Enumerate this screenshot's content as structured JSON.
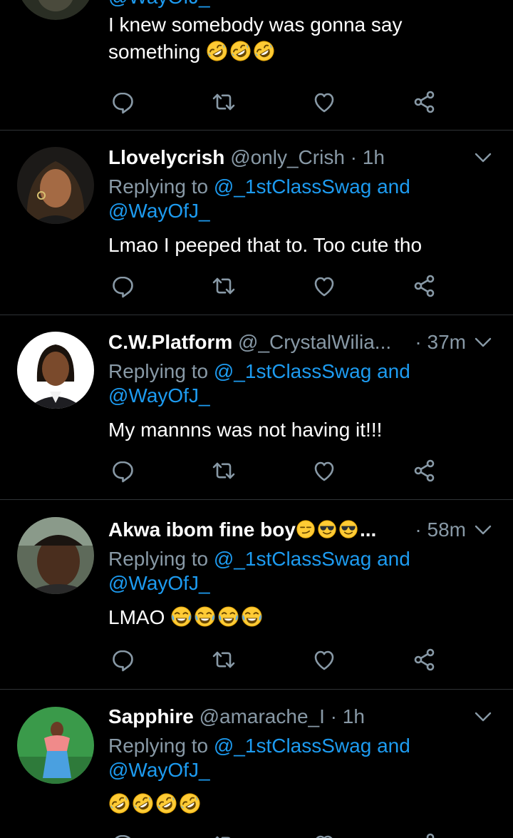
{
  "tweets": [
    {
      "partial_handle": "@WayOfJ_",
      "text": "I knew somebody was gonna say",
      "text_line2": "something",
      "emojis": "🤣🤣🤣"
    },
    {
      "name": "Llovelycrish",
      "handle": "@only_Crish",
      "time": "1h",
      "replying_prefix": "Replying to",
      "mention1": "@_1stClassSwag",
      "and": "and",
      "mention2": "@WayOfJ_",
      "text": "Lmao I peeped that to. Too cute tho"
    },
    {
      "name": "C.W.Platform",
      "handle": "@_CrystalWilia...",
      "time": "37m",
      "replying_prefix": "Replying to",
      "mention1": "@_1stClassSwag",
      "and": "and",
      "mention2": "@WayOfJ_",
      "text": "My mannns was not having it!!!"
    },
    {
      "name": "Akwa ibom fine boy",
      "name_suffix": "...",
      "name_emojis": "😏😎😎",
      "time": "58m",
      "replying_prefix": "Replying to",
      "mention1": "@_1stClassSwag",
      "and": "and",
      "mention2": "@WayOfJ_",
      "text": "LMAO",
      "emojis": "😂😂😂😂"
    },
    {
      "name": "Sapphire",
      "handle": "@amarache_I",
      "time": "1h",
      "replying_prefix": "Replying to",
      "mention1": "@_1stClassSwag",
      "and": "and",
      "mention2": "@WayOfJ_",
      "emojis": "🤣🤣🤣🤣"
    }
  ],
  "colors": {
    "background": "#000000",
    "secondary_text": "#8899a6",
    "mention": "#1d9bf0",
    "divider": "#2f3336"
  },
  "icons": [
    "reply-icon",
    "retweet-icon",
    "like-icon",
    "share-icon",
    "chevron-down-icon"
  ]
}
